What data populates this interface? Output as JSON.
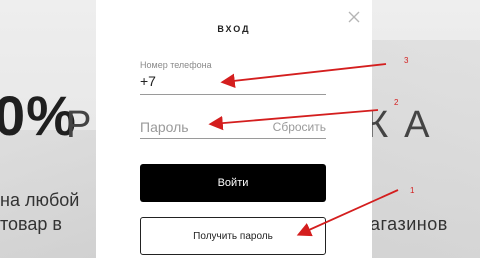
{
  "background": {
    "big_left": "0%",
    "big_r": "Р",
    "big_right": "КА",
    "line1": "на любой",
    "line2": "товар в",
    "right_line": "агазинов"
  },
  "modal": {
    "title": "ВХОД",
    "close_icon": "close-icon",
    "phone": {
      "label": "Номер телефона",
      "value": "+7"
    },
    "password": {
      "placeholder": "Пароль",
      "reset_label": "Сбросить"
    },
    "login_button": "Войти",
    "get_password_button": "Получить пароль"
  },
  "annotations": {
    "color": "#d41e1e",
    "markers": [
      "3",
      "2",
      "1"
    ]
  }
}
